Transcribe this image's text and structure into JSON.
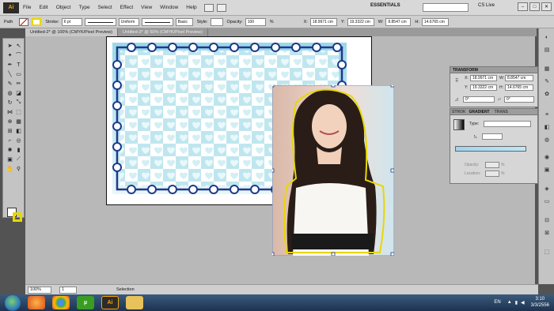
{
  "menubar": {
    "logo": "Ai",
    "items": [
      "File",
      "Edit",
      "Object",
      "Type",
      "Select",
      "Effect",
      "View",
      "Window",
      "Help"
    ],
    "workspace": "ESSENTIALS",
    "cs_live": "CS Live"
  },
  "control_bar": {
    "selection_type": "Path",
    "stroke_label": "Stroke:",
    "stroke_weight": "6 pt",
    "profile": "Uniform",
    "brush": "Basic",
    "style_label": "Style:",
    "opacity_label": "Opacity:",
    "opacity_value": "100",
    "opacity_unit": "%",
    "x_label": "X:",
    "x_value": "18.9971 cm",
    "y_label": "Y:",
    "y_value": "19.3322 cm",
    "w_label": "W:",
    "w_value": "8.8547 cm",
    "h_label": "H:",
    "h_value": "14.6765 cm"
  },
  "doc_tabs": [
    {
      "label": "Untitled-2* @ 100% (CMYK/Pixel Preview)"
    },
    {
      "label": "Untitled-3* @ 50% (CMYK/Pixel Preview)"
    }
  ],
  "transform_panel": {
    "title": "TRANSFORM",
    "x_label": "X:",
    "x_value": "18.9971 cm",
    "y_label": "Y:",
    "y_value": "19.3322 cm",
    "w_label": "W:",
    "w_value": "8.8547 cm",
    "h_label": "H:",
    "h_value": "14.6765 cm",
    "rotate_value": "0°",
    "shear_value": "0°"
  },
  "gradient_panel": {
    "tab_stroke": "STROK",
    "tab_gradient": "GRADIENT",
    "tab_transparency": "TRANS",
    "type_label": "Type:",
    "opacity_label": "Opacity:",
    "location_label": "Location:",
    "percent": "%"
  },
  "statusbar": {
    "zoom": "100%",
    "page": "1",
    "tool": "Selection"
  },
  "taskbar": {
    "apps": [
      "firefox",
      "chrome",
      "utorrent",
      "Ai",
      "explorer"
    ],
    "lang": "EN",
    "time": "3:10",
    "date": "3/3/2556"
  },
  "colors": {
    "stamp_blue": "#cfeef2",
    "stamp_border": "#1e3a8a",
    "selection_yellow": "#e6d800",
    "ui_gray": "#cfcfcf"
  }
}
